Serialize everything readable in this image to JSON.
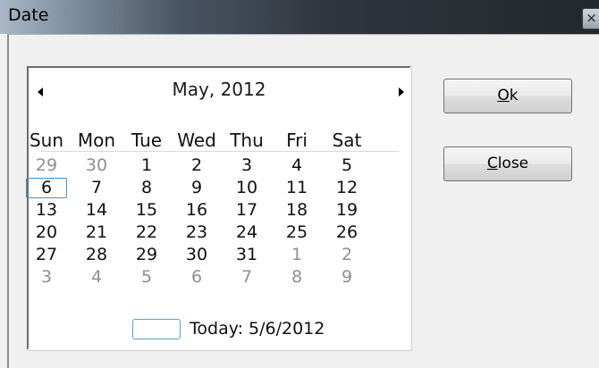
{
  "window": {
    "title": "Date",
    "close_glyph": "×"
  },
  "calendar": {
    "month_label": "May, 2012",
    "weekdays": [
      "Sun",
      "Mon",
      "Tue",
      "Wed",
      "Thu",
      "Fri",
      "Sat"
    ],
    "weeks": [
      [
        "29",
        "30",
        "1",
        "2",
        "3",
        "4",
        "5"
      ],
      [
        "6",
        "7",
        "8",
        "9",
        "10",
        "11",
        "12"
      ],
      [
        "13",
        "14",
        "15",
        "16",
        "17",
        "18",
        "19"
      ],
      [
        "20",
        "21",
        "22",
        "23",
        "24",
        "25",
        "26"
      ],
      [
        "27",
        "28",
        "29",
        "30",
        "31",
        "1",
        "2"
      ],
      [
        "3",
        "4",
        "5",
        "6",
        "7",
        "8",
        "9"
      ]
    ],
    "today_label": "Today: 5/6/2012",
    "selected_day": "6"
  },
  "buttons": {
    "ok": {
      "accel": "O",
      "rest": "k"
    },
    "close": {
      "accel": "C",
      "rest": "lose"
    }
  },
  "colors": {
    "selection_border": "#4a90c8",
    "other_month_text": "#8f8f8f"
  }
}
